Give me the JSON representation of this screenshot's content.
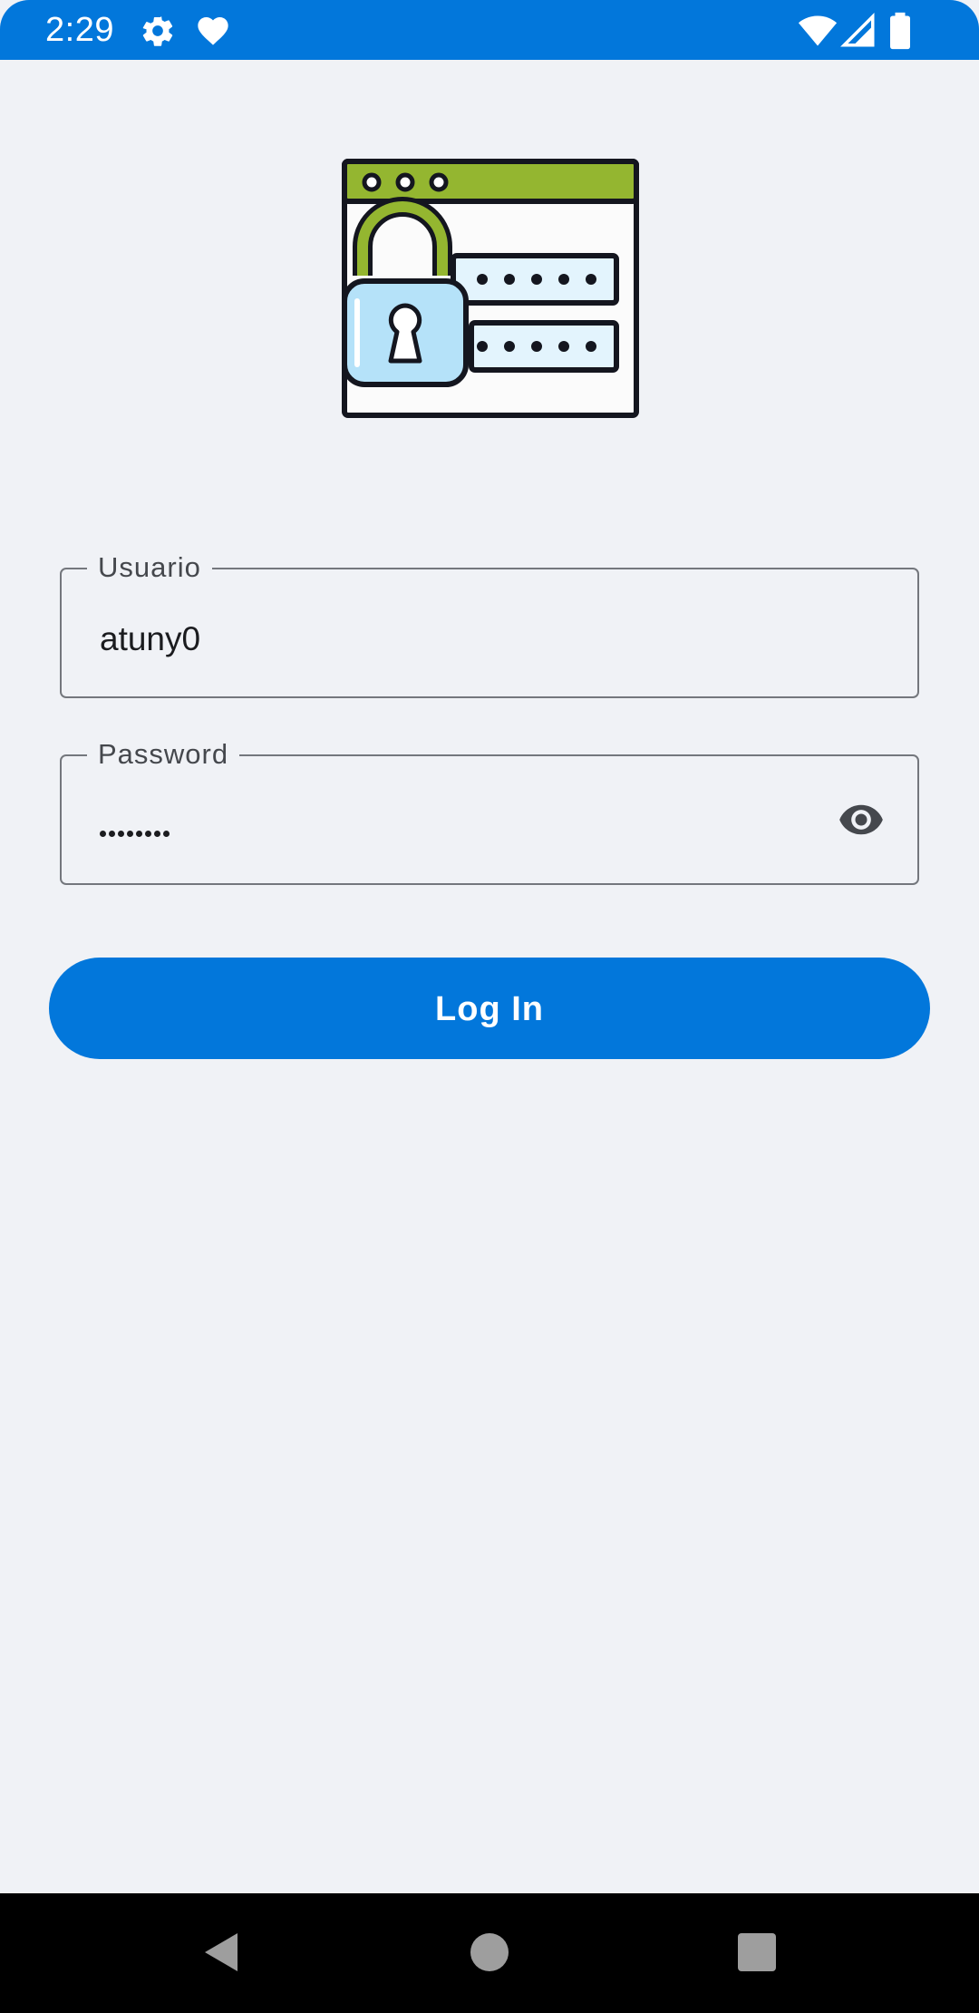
{
  "status_bar": {
    "time": "2:29",
    "background": "#0277db",
    "left_icons": [
      "gear-icon",
      "heart-icon"
    ],
    "right_icons": [
      "wifi-icon",
      "signal-icon",
      "battery-icon"
    ]
  },
  "hero": {
    "icon": "login-padlock-illustration",
    "accent": "#94b630",
    "lock_fill": "#b5e2f9"
  },
  "form": {
    "username": {
      "label": "Usuario",
      "value": "atuny0"
    },
    "password": {
      "label": "Password",
      "masked_length": 8,
      "visibility_icon": "eye-icon"
    },
    "submit_label": "Log In"
  },
  "colors": {
    "accent": "#0277db",
    "background": "#f0f2f6",
    "field_border": "#74777d"
  },
  "nav_bar": {
    "buttons": [
      "back-icon",
      "home-icon",
      "recents-icon"
    ]
  }
}
